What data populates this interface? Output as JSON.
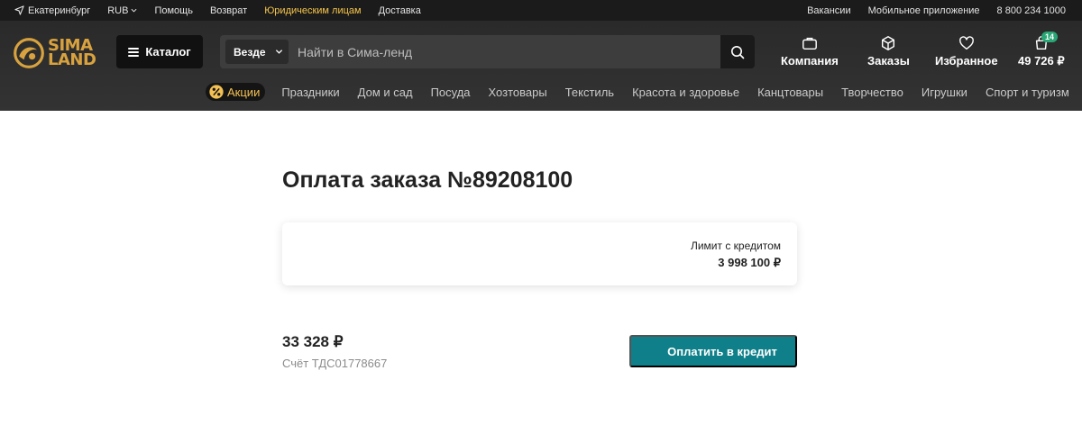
{
  "topbar": {
    "city": "Екатеринбург",
    "currency": "RUB",
    "help": "Помощь",
    "returns": "Возврат",
    "legal": "Юридическим лицам",
    "delivery": "Доставка",
    "jobs": "Вакансии",
    "mobile_app": "Мобильное приложение",
    "phone": "8 800 234 1000"
  },
  "header": {
    "logo_line1": "SIMA",
    "logo_line2": "LAND",
    "catalog": "Каталог",
    "search_scope": "Везде",
    "search_placeholder": "Найти в Сима-ленд",
    "company": "Компания",
    "orders": "Заказы",
    "favorites": "Избранное",
    "cart_total": "49 726 ₽",
    "cart_count": "14"
  },
  "catnav": {
    "promo": "Акции",
    "items": [
      "Праздники",
      "Дом и сад",
      "Посуда",
      "Хозтовары",
      "Текстиль",
      "Красота и здоровье",
      "Канцтовары",
      "Творчество",
      "Игрушки",
      "Спорт и туризм"
    ]
  },
  "content": {
    "title": "Оплата заказа №89208100",
    "limit_label": "Лимит с кредитом",
    "limit_value": "3 998 100 ₽",
    "amount": "33 328 ₽",
    "invoice": "Счёт ТДС01778667",
    "pay_button": "Оплатить в кредит"
  },
  "colors": {
    "accent": "#0f7f89",
    "brand_gold": "#d8a23f",
    "legal_highlight": "#f6c64a",
    "badge": "#2aa776"
  }
}
